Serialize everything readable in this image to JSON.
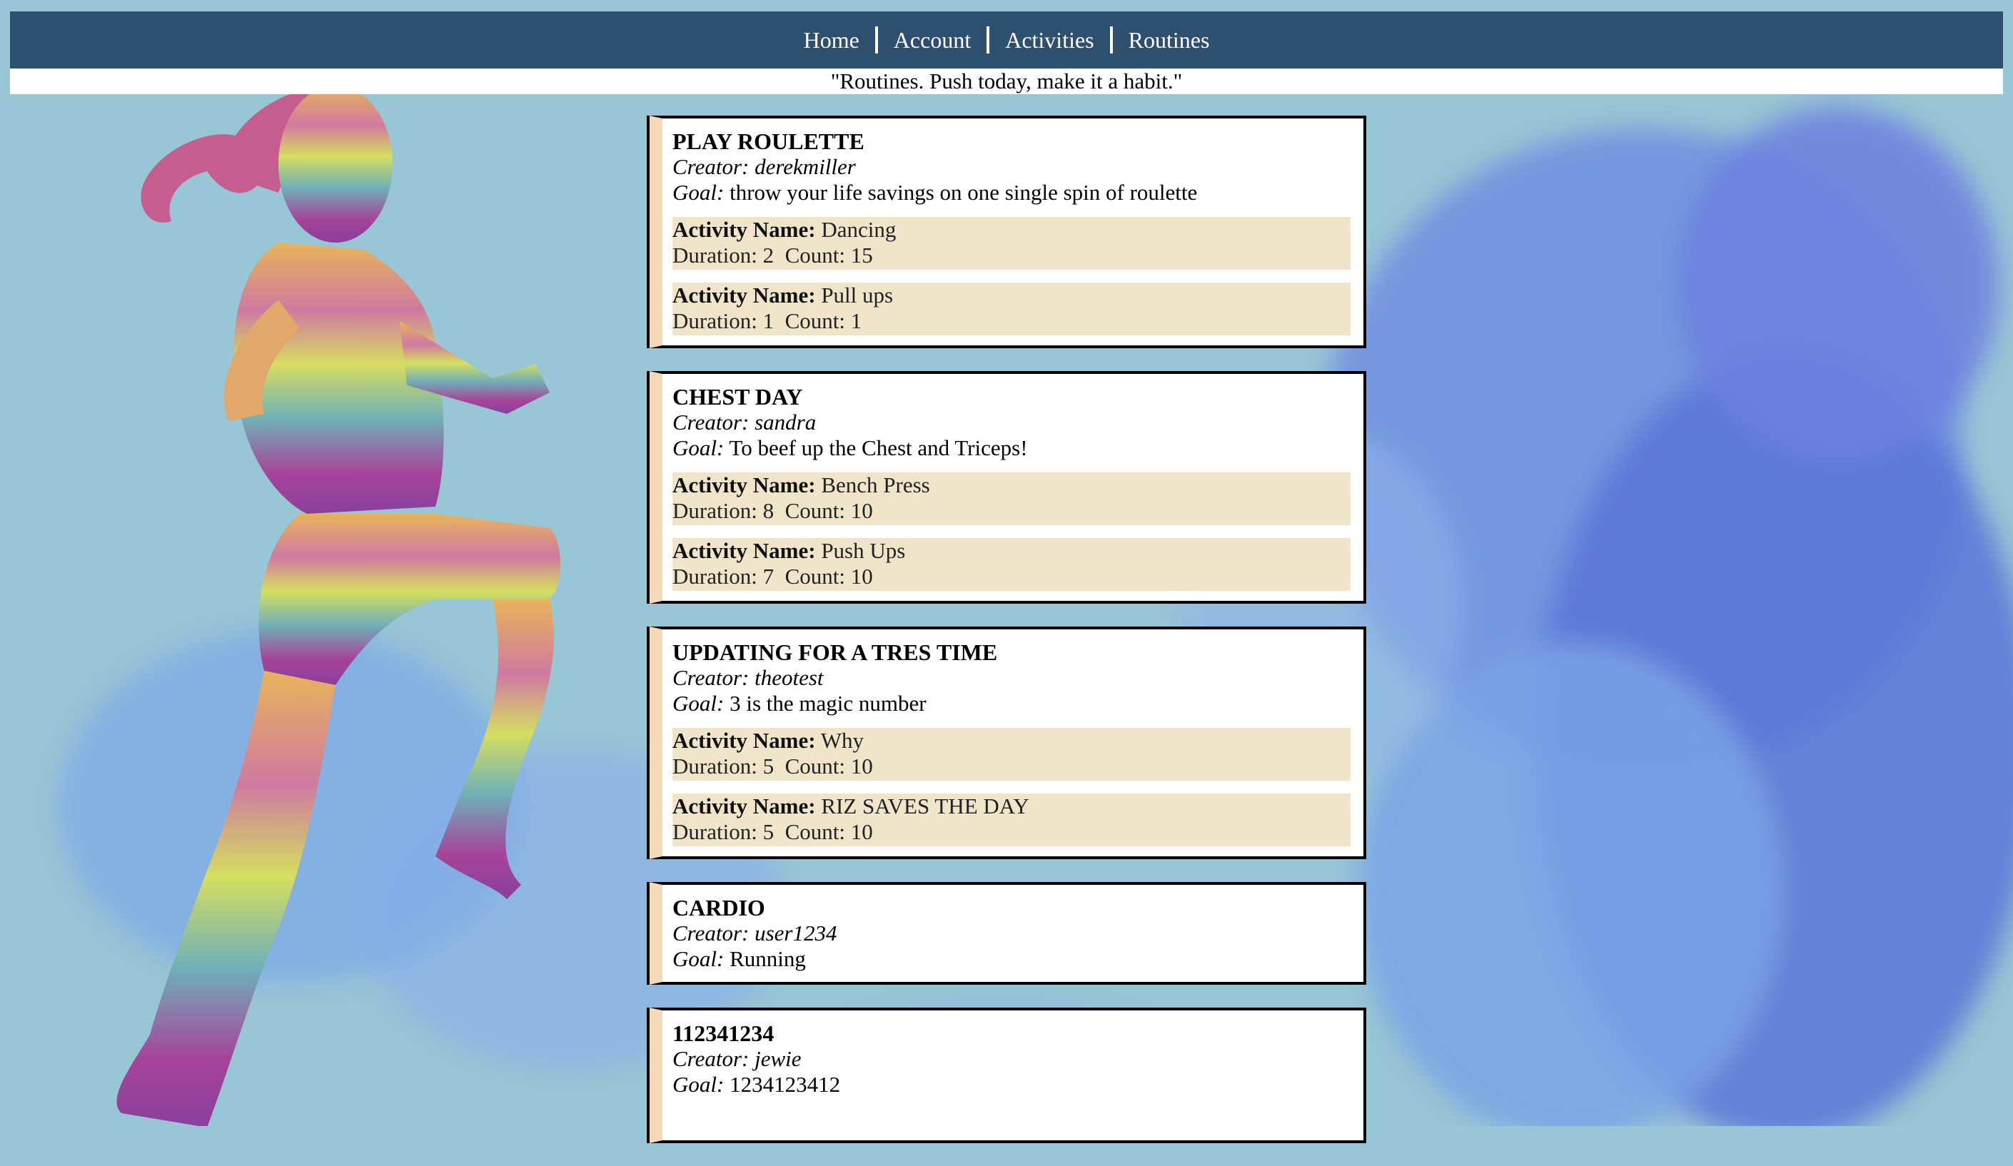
{
  "nav": {
    "items": [
      "Home",
      "Account",
      "Activities",
      "Routines"
    ]
  },
  "tagline": "\"Routines. Push today, make it a habit.\"",
  "labels": {
    "creator": "Creator:",
    "goal": "Goal:",
    "activity_name": "Activity Name:",
    "duration": "Duration:",
    "count": "Count:"
  },
  "routines": [
    {
      "name": "PLAY ROULETTE",
      "creator": "derekmiller",
      "goal": "throw your life savings on one single spin of roulette",
      "activities": [
        {
          "name": "Dancing",
          "duration": "2",
          "count": "15"
        },
        {
          "name": "Pull ups",
          "duration": "1",
          "count": "1"
        }
      ]
    },
    {
      "name": "CHEST DAY",
      "creator": "sandra",
      "goal": "To beef up the Chest and Triceps!",
      "activities": [
        {
          "name": "Bench Press",
          "duration": "8",
          "count": "10"
        },
        {
          "name": "Push Ups",
          "duration": "7",
          "count": "10"
        }
      ]
    },
    {
      "name": "UPDATING FOR A TRES TIME",
      "creator": "theotest",
      "goal": "3 is the magic number",
      "activities": [
        {
          "name": "Why",
          "duration": "5",
          "count": "10"
        },
        {
          "name": "RIZ SAVES THE DAY",
          "duration": "5",
          "count": "10"
        }
      ]
    },
    {
      "name": "CARDIO",
      "creator": "user1234",
      "goal": "Running",
      "activities": []
    },
    {
      "name": "112341234",
      "creator": "jewie",
      "goal": "1234123412",
      "activities": []
    }
  ],
  "colors": {
    "navbar": "#2e4f6e",
    "background": "#98c6d4",
    "activity_bg": "#f0e4c9",
    "card_accent": "#f3d9b8"
  }
}
